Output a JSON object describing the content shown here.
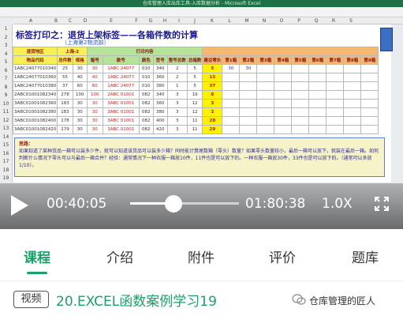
{
  "video": {
    "window_title": "仓库管理入库出库工具-入库数据分析 - Microsoft Excel",
    "column_letters": [
      "A",
      "B",
      "C",
      "D",
      "E",
      "F",
      "G",
      "H",
      "I",
      "J",
      "K",
      "L",
      "M",
      "N",
      "O",
      "P",
      "Q",
      "R",
      "S"
    ],
    "row_numbers": [
      "1",
      "2",
      "3",
      "4",
      "5",
      "6",
      "7",
      "8",
      "9",
      "10",
      "11",
      "12",
      "13",
      "14",
      "15",
      "16",
      "17",
      "18",
      "19"
    ],
    "sheet_title": "标签打印之：退货上架标签——各箱件数的计算",
    "sheet_subtitle": "（上海第2物流部）",
    "group_headers": [
      "退货地区",
      "上海-2",
      "打印内容"
    ],
    "col_headers": [
      "物品代码",
      "总件数",
      "规格",
      "箱号",
      "款号",
      "颜色",
      "型号",
      "整号总数",
      "总箱数",
      "建议零头",
      "第1箱",
      "第2箱",
      "第3箱",
      "第4箱",
      "第5箱",
      "第6箱",
      "第7箱",
      "第8箱",
      "第9箱"
    ],
    "rows": [
      [
        "1ABC24077010340",
        "25",
        "30",
        "30",
        "1ABC 24077",
        "010",
        "340",
        "2",
        "5",
        "5",
        "30",
        "30"
      ],
      [
        "1ABC24077010360",
        "55",
        "40",
        "40",
        "1ABC 24077",
        "010",
        "360",
        "2",
        "5",
        "15",
        "",
        ""
      ],
      [
        "1ABC24077010380",
        "37",
        "60",
        "60",
        "1ABC 24077",
        "010",
        "380",
        "1",
        "5",
        "37",
        "",
        ""
      ],
      [
        "2ABC01001082340",
        "278",
        "100",
        "100",
        "2ABC 01001",
        "082",
        "340",
        "3",
        "19",
        "8",
        "",
        ""
      ],
      [
        "3ABC01001082360",
        "183",
        "30",
        "30",
        "3ABC 01001",
        "082",
        "360",
        "3",
        "12",
        "3",
        "",
        ""
      ],
      [
        "3ABC01001082380",
        "183",
        "30",
        "30",
        "3ABC 01001",
        "082",
        "380",
        "3",
        "12",
        "3",
        "",
        ""
      ],
      [
        "3ABC01001082400",
        "178",
        "30",
        "30",
        "3ABC 01001",
        "082",
        "400",
        "3",
        "11",
        "28",
        "",
        ""
      ],
      [
        "3ABC01001082420",
        "179",
        "30",
        "30",
        "3ABC 01001",
        "082",
        "420",
        "3",
        "11",
        "29",
        "",
        ""
      ]
    ],
    "note_title": "思路：",
    "note_text": "如果知道了某种货品一箱可以装多少件，就可以知道该货品可以装多少箱？同时能计算尾数箱（零头）数量？如果零头数量较小，最后一箱可以放下，就装在最后一箱。如何判断什么情况下零头可以与最后一箱合并？经验：通常情况下一种衣服一箱放10件，11件也是可以放下的。一种衣服一箱放30件，33件也是可以放下的。（通常可以多放1/10）。",
    "current_time": "00:40:05",
    "duration": "01:80:38",
    "speed": "1.0X",
    "progress_fraction": 0.4
  },
  "tabs": [
    "课程",
    "介绍",
    "附件",
    "评价",
    "题库"
  ],
  "active_tab": "课程",
  "course": {
    "badge": "视频",
    "title": "20.EXCEL函数案例学习19"
  },
  "watermark": "仓库管理的匠人",
  "colors": {
    "accent": "#1aa169",
    "excel_green": "#1e7145"
  }
}
